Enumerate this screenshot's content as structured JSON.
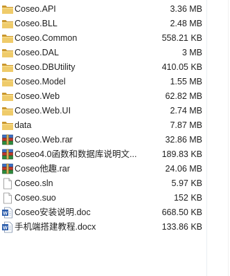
{
  "files": [
    {
      "name": "Coseo.API",
      "size": "3.36 MB",
      "type": "folder",
      "icon": "folder-icon"
    },
    {
      "name": "Coseo.BLL",
      "size": "2.48 MB",
      "type": "folder",
      "icon": "folder-icon"
    },
    {
      "name": "Coseo.Common",
      "size": "558.21 KB",
      "type": "folder",
      "icon": "folder-icon"
    },
    {
      "name": "Coseo.DAL",
      "size": "3 MB",
      "type": "folder",
      "icon": "folder-icon"
    },
    {
      "name": "Coseo.DBUtility",
      "size": "410.05 KB",
      "type": "folder",
      "icon": "folder-icon"
    },
    {
      "name": "Coseo.Model",
      "size": "1.55 MB",
      "type": "folder",
      "icon": "folder-icon"
    },
    {
      "name": "Coseo.Web",
      "size": "62.82 MB",
      "type": "folder",
      "icon": "folder-icon"
    },
    {
      "name": "Coseo.Web.UI",
      "size": "2.74 MB",
      "type": "folder",
      "icon": "folder-icon"
    },
    {
      "name": "data",
      "size": "7.87 MB",
      "type": "folder",
      "icon": "folder-icon"
    },
    {
      "name": "Coseo.Web.rar",
      "size": "32.86 MB",
      "type": "rar",
      "icon": "winrar-archive-icon"
    },
    {
      "name": "Coseo4.0函数和数据库说明文...",
      "size": "189.83 KB",
      "type": "rar",
      "icon": "winrar-archive-icon"
    },
    {
      "name": "Coseo他趣.rar",
      "size": "24.06 MB",
      "type": "rar",
      "icon": "winrar-archive-icon"
    },
    {
      "name": "Coseo.sln",
      "size": "5.97 KB",
      "type": "file",
      "icon": "blank-file-icon"
    },
    {
      "name": "Coseo.suo",
      "size": "152 KB",
      "type": "file",
      "icon": "blank-file-icon"
    },
    {
      "name": "Coseo安装说明.doc",
      "size": "668.50 KB",
      "type": "doc",
      "icon": "word-document-icon"
    },
    {
      "name": "手机端搭建教程.docx",
      "size": "133.86 KB",
      "type": "doc",
      "icon": "word-document-icon"
    }
  ],
  "colors": {
    "folder": "#e8c15a",
    "folder_dark": "#c9962d",
    "rar_blue": "#3a6fc4",
    "rar_red": "#c0392b",
    "rar_green": "#2e8b3e",
    "word_blue": "#2a5cab"
  }
}
